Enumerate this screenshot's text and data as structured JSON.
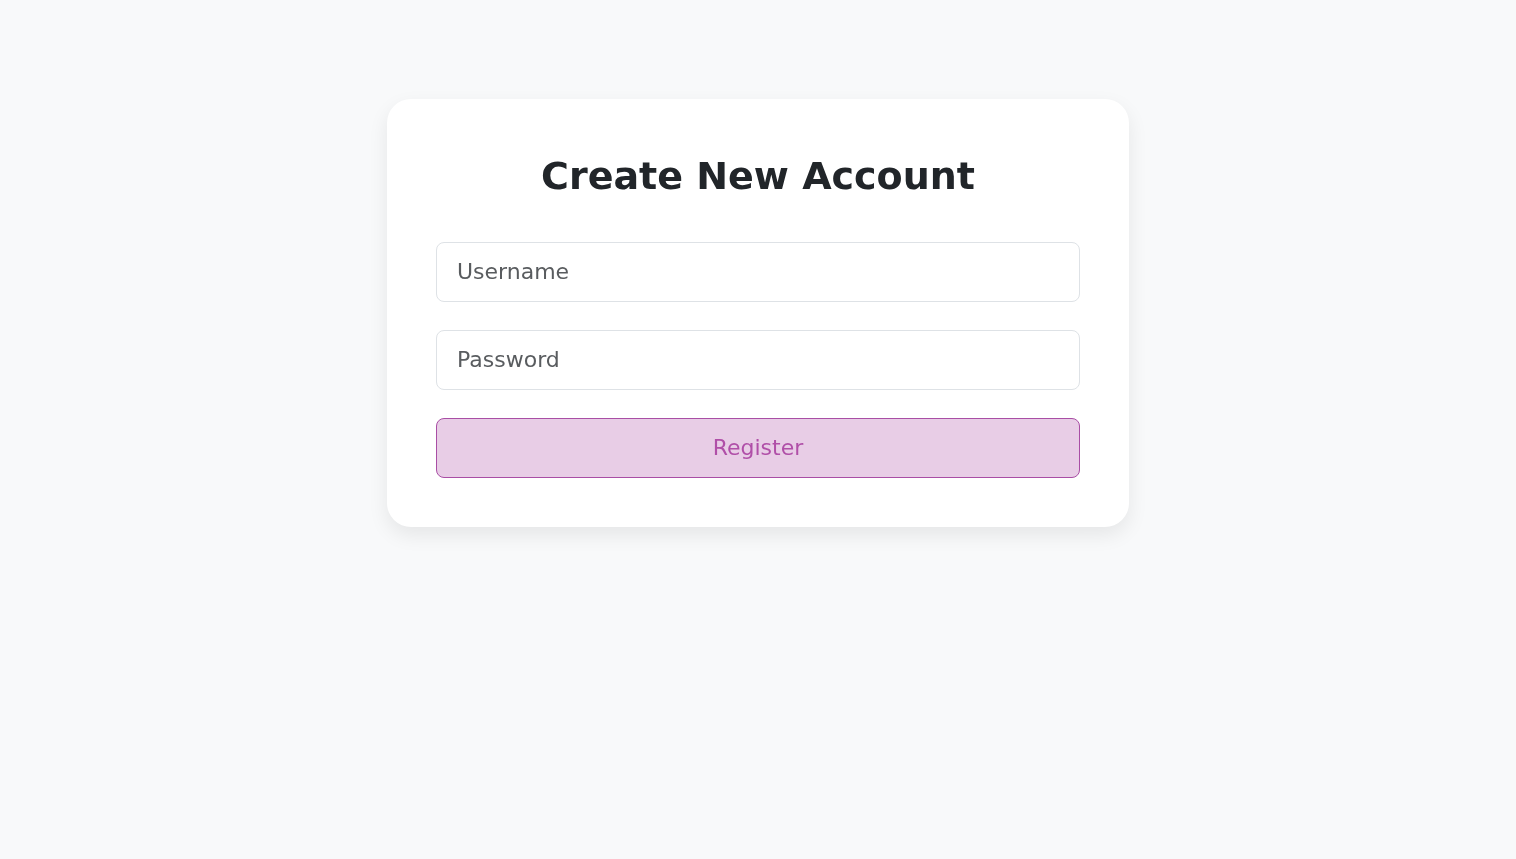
{
  "form": {
    "title": "Create New Account",
    "fields": [
      {
        "placeholder": "Username"
      },
      {
        "placeholder": "Password"
      }
    ],
    "button": {
      "label": "Register"
    }
  }
}
